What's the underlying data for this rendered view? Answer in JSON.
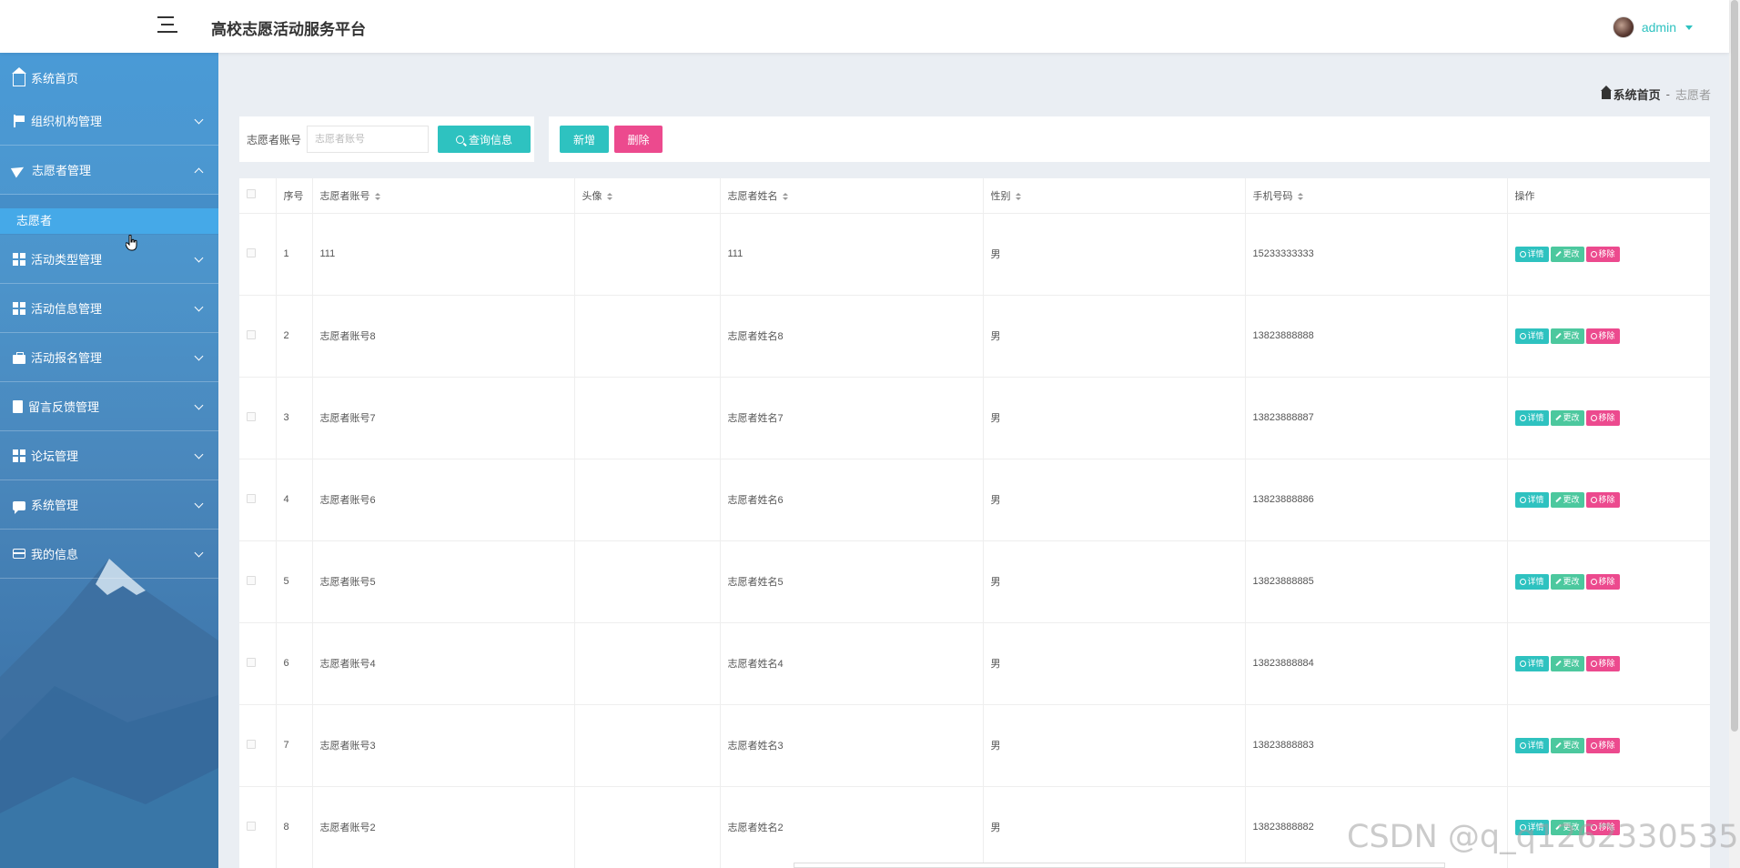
{
  "header": {
    "title": "高校志愿活动服务平台",
    "user": "admin"
  },
  "sidebar": {
    "home": "系统首页",
    "items": [
      {
        "label": "组织机构管理",
        "icon": "flag-icon"
      },
      {
        "label": "志愿者管理",
        "icon": "send-icon",
        "expanded": true
      },
      {
        "label": "活动类型管理",
        "icon": "grid-icon"
      },
      {
        "label": "活动信息管理",
        "icon": "grid-icon"
      },
      {
        "label": "活动报名管理",
        "icon": "briefcase-icon"
      },
      {
        "label": "留言反馈管理",
        "icon": "clipboard-icon"
      },
      {
        "label": "论坛管理",
        "icon": "grid-icon"
      },
      {
        "label": "系统管理",
        "icon": "chat-icon"
      },
      {
        "label": "我的信息",
        "icon": "card-icon"
      }
    ],
    "active_sub": "志愿者"
  },
  "breadcrumb": {
    "home": "系统首页",
    "separator": "-",
    "current": "志愿者"
  },
  "search": {
    "label": "志愿者账号",
    "placeholder": "志愿者账号",
    "button": "查询信息"
  },
  "actions": {
    "add": "新增",
    "delete": "删除"
  },
  "table": {
    "columns": [
      "序号",
      "志愿者账号",
      "头像",
      "志愿者姓名",
      "性别",
      "手机号码",
      "操作"
    ],
    "rows": [
      {
        "no": "1",
        "account": "111",
        "avatar": "",
        "name": "111",
        "gender": "男",
        "phone": "15233333333"
      },
      {
        "no": "2",
        "account": "志愿者账号8",
        "avatar": "",
        "name": "志愿者姓名8",
        "gender": "男",
        "phone": "13823888888"
      },
      {
        "no": "3",
        "account": "志愿者账号7",
        "avatar": "",
        "name": "志愿者姓名7",
        "gender": "男",
        "phone": "13823888887"
      },
      {
        "no": "4",
        "account": "志愿者账号6",
        "avatar": "",
        "name": "志愿者姓名6",
        "gender": "男",
        "phone": "13823888886"
      },
      {
        "no": "5",
        "account": "志愿者账号5",
        "avatar": "",
        "name": "志愿者姓名5",
        "gender": "男",
        "phone": "13823888885"
      },
      {
        "no": "6",
        "account": "志愿者账号4",
        "avatar": "",
        "name": "志愿者姓名4",
        "gender": "男",
        "phone": "13823888884"
      },
      {
        "no": "7",
        "account": "志愿者账号3",
        "avatar": "",
        "name": "志愿者姓名3",
        "gender": "男",
        "phone": "13823888883"
      },
      {
        "no": "8",
        "account": "志愿者账号2",
        "avatar": "",
        "name": "志愿者姓名2",
        "gender": "男",
        "phone": "13823888882"
      }
    ],
    "row_actions": {
      "detail": "详情",
      "edit": "更改",
      "remove": "移除"
    }
  },
  "watermark": "CSDN @q_q1262330535",
  "colors": {
    "accent": "#2ec2c0",
    "edit": "#4cc89e",
    "danger": "#ec4a8e",
    "sidebar": "#4a90c8",
    "active_sub": "#45a9e8"
  }
}
